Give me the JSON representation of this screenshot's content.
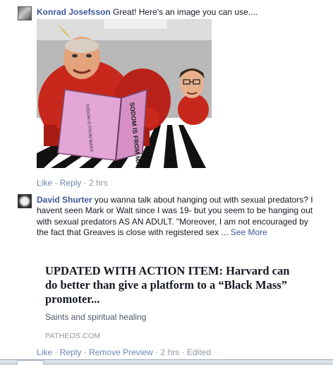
{
  "comment1": {
    "author": "Konrad Josefsson",
    "text": "Great! Here's an image you can use....",
    "like": "Like",
    "reply": "Reply",
    "time": "2 hrs",
    "image": {
      "book_title": "SODOM IS FROM MARS",
      "book_spine": "SODOM IS FROM MARS"
    }
  },
  "comment2": {
    "author": "David Shurter",
    "text": "you wanna talk about hanging out with sexual predators? I havent seen Mark or Walt since I was 19- but you seem to be hanging out with sexual predators AS AN ADULT. \"Moreover, I am not encouraged by the fact that Greaves is close with registered sex ...",
    "see_more": "See More",
    "like": "Like",
    "reply": "Reply",
    "remove_preview": "Remove Preview",
    "time": "2 hrs",
    "edited": "Edited",
    "link_preview": {
      "title": "UPDATED WITH ACTION ITEM: Harvard can do better than give a platform to a “Black Mass” promoter...",
      "description": "Saints and spiritual healing",
      "source": "PATHEOS.COM"
    }
  },
  "colors": {
    "link": "#3b5998",
    "action": "#6d84b4",
    "meta": "#9197a3",
    "devil_red": "#c8281c",
    "book_pink": "#e4a6d6"
  },
  "icons": [
    "avatar-icon"
  ]
}
